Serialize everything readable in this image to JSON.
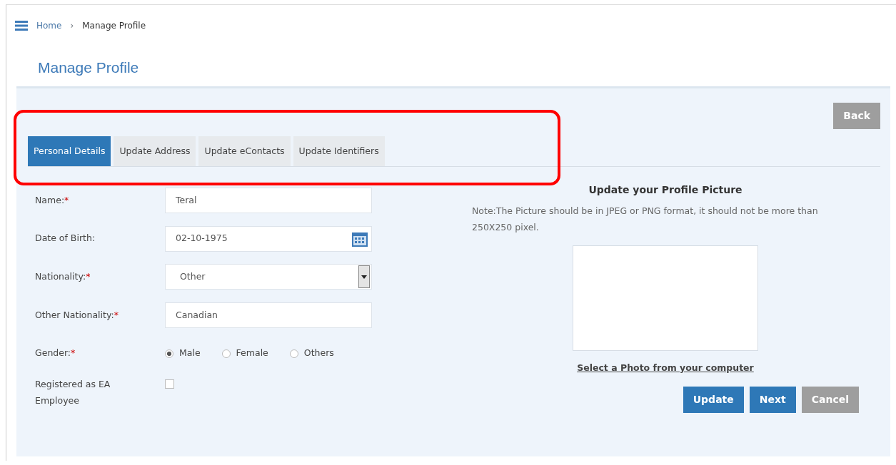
{
  "breadcrumb": [
    {
      "label": "Home"
    },
    {
      "label": "Manage Profile"
    }
  ],
  "breadcrumb_separator": "›",
  "page_title": "Manage Profile",
  "back_button": "Back",
  "tabs": [
    {
      "label": "Personal Details",
      "selected": true
    },
    {
      "label": "Update Address",
      "selected": false
    },
    {
      "label": "Update eContacts",
      "selected": false
    },
    {
      "label": "Update Identifiers",
      "selected": false
    }
  ],
  "form": [
    {
      "kind": "text",
      "label": "Name:",
      "required": true,
      "value": "Teral"
    },
    {
      "kind": "date",
      "label": "Date of Birth:",
      "required": false,
      "value": "02-10-1975"
    },
    {
      "kind": "select",
      "label": "Nationality:",
      "required": true,
      "value": "Other"
    },
    {
      "kind": "text",
      "label": "Other Nationality:",
      "required": true,
      "value": "Canadian"
    },
    {
      "kind": "radio",
      "label": "Gender:",
      "required": true,
      "options": [
        {
          "label": "Male",
          "selected": true
        },
        {
          "label": "Female",
          "selected": false
        },
        {
          "label": "Others",
          "selected": false
        }
      ]
    },
    {
      "kind": "checkbox",
      "label": "Registered as EA Employee",
      "required": false,
      "checked": false
    }
  ],
  "required_mark": "*",
  "photo": {
    "title": "Update your Profile Picture",
    "note": "Note:The Picture should be in JPEG or PNG format, it should not be more than 250X250 pixel.",
    "select_link": "Select a Photo from your computer"
  },
  "buttons": [
    {
      "label": "Update",
      "kind": "primary"
    },
    {
      "label": "Next",
      "kind": "primary"
    },
    {
      "label": "Cancel",
      "kind": "secondary"
    }
  ]
}
